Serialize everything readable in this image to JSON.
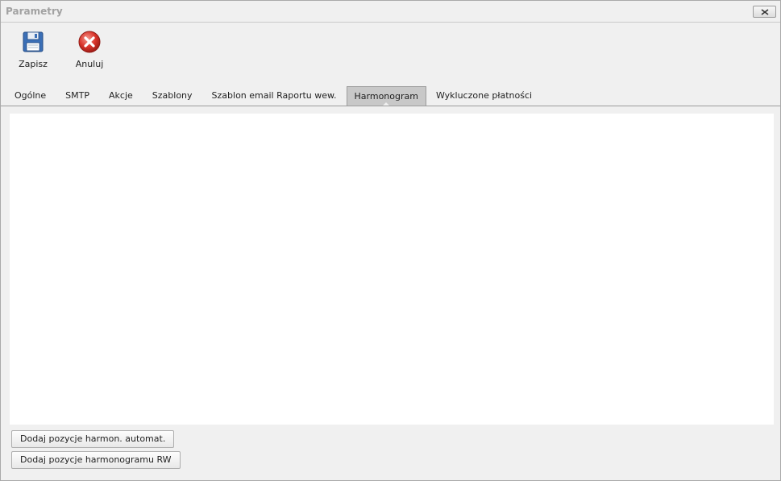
{
  "window": {
    "title": "Parametry"
  },
  "toolbar": {
    "save_label": "Zapisz",
    "save_icon": "floppy-disk-icon",
    "cancel_label": "Anuluj",
    "cancel_icon": "cancel-x-icon"
  },
  "tabs": [
    {
      "label": "Ogólne"
    },
    {
      "label": "SMTP"
    },
    {
      "label": "Akcje"
    },
    {
      "label": "Szablony"
    },
    {
      "label": "Szablon email Raportu wew."
    },
    {
      "label": "Harmonogram",
      "active": true
    },
    {
      "label": "Wykluczone płatności"
    }
  ],
  "actions": {
    "add_auto_label": "Dodaj pozycje harmon. automat.",
    "add_rw_label": "Dodaj pozycje harmonogramu RW"
  },
  "colors": {
    "active_tab": "#c8c8c8",
    "cancel_red": "#d9342b",
    "floppy_blue": "#3b6fb6"
  }
}
